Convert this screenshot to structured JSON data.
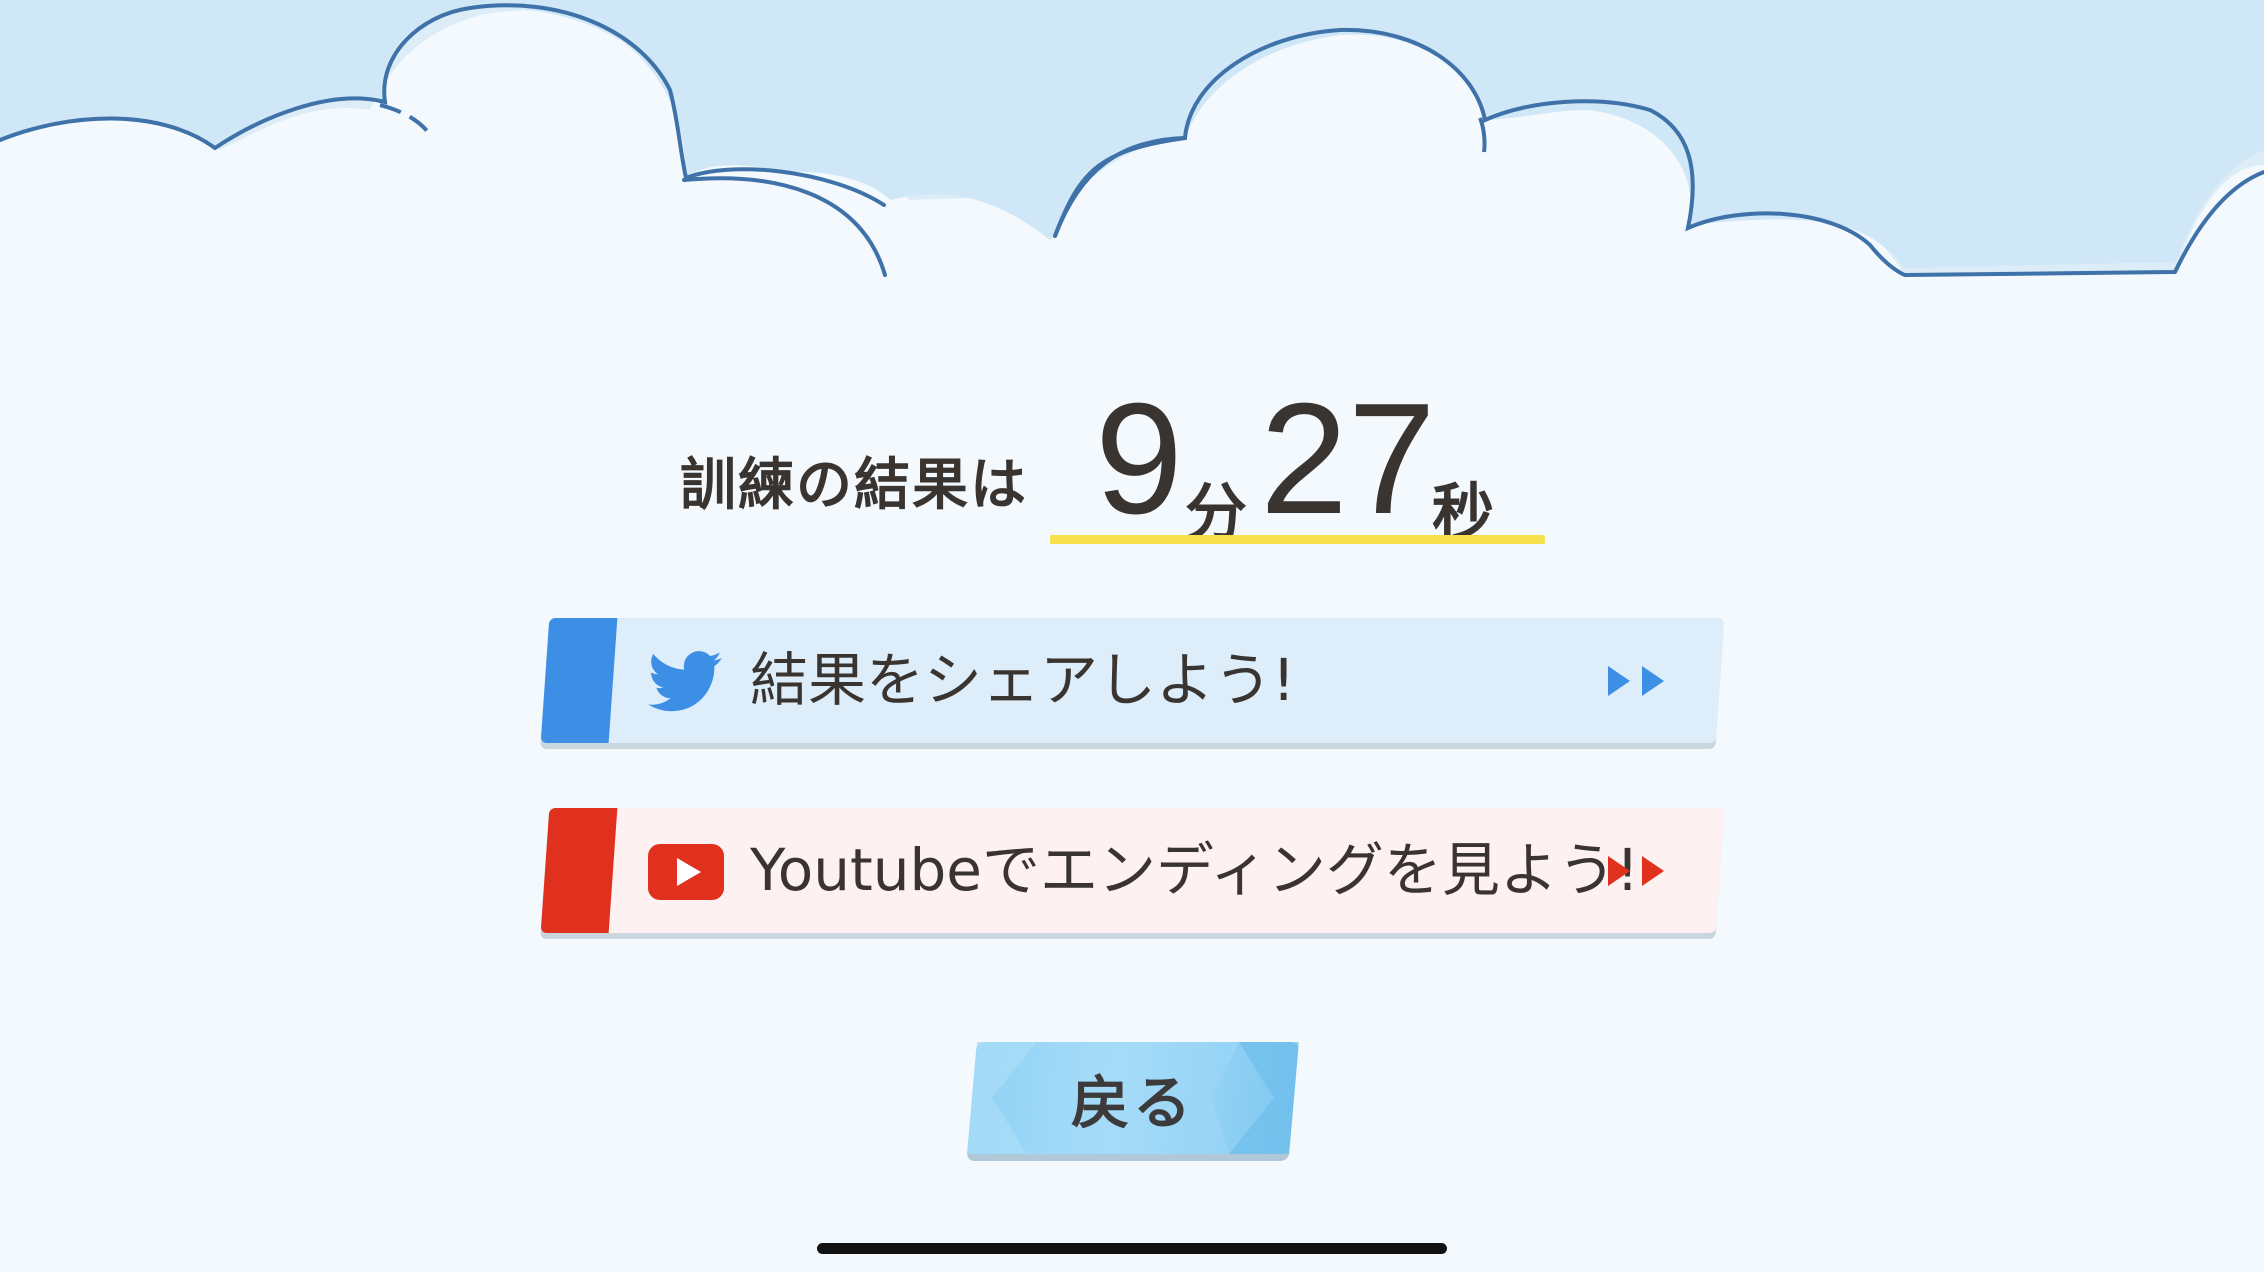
{
  "result": {
    "label": "訓練の結果は",
    "minutes": "9",
    "minutes_unit": "分",
    "seconds": "27",
    "seconds_unit": "秒"
  },
  "buttons": {
    "twitter_label": "結果をシェアしよう!",
    "twitter_icon": "twitter-bird-icon",
    "youtube_label": "Youtubeでエンディングを見よう!",
    "youtube_icon": "youtube-play-icon",
    "back_label": "戻る"
  },
  "colors": {
    "twitter_blue": "#3d8fe6",
    "youtube_red": "#e0301e",
    "time_underline": "#f6e04b",
    "back_button": "#8fd1f4"
  }
}
